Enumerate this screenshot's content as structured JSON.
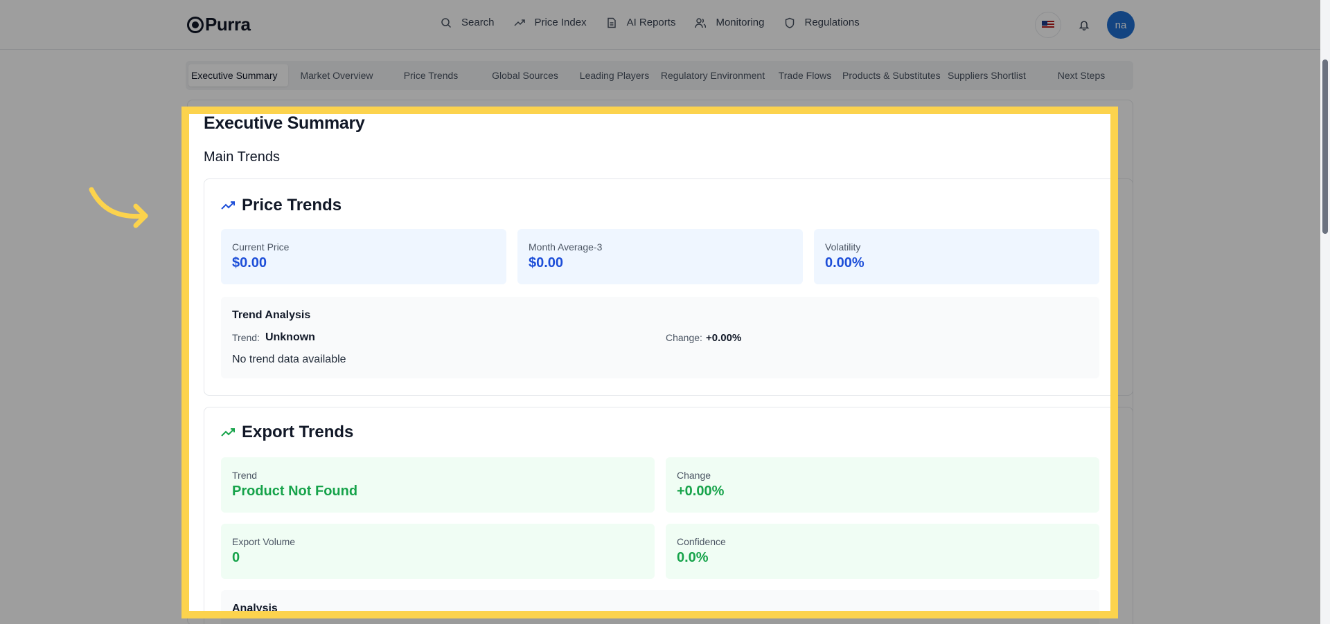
{
  "app": {
    "logo_text": "Purra"
  },
  "nav": [
    {
      "label": "Search",
      "icon": "search-icon"
    },
    {
      "label": "Price Index",
      "icon": "trending-up-icon"
    },
    {
      "label": "AI Reports",
      "icon": "document-icon"
    },
    {
      "label": "Monitoring",
      "icon": "users-icon"
    },
    {
      "label": "Regulations",
      "icon": "shield-icon"
    }
  ],
  "user": {
    "initials": "na",
    "flag": "us-flag-icon"
  },
  "tabs": [
    "Executive Summary",
    "Market Overview",
    "Price Trends",
    "Global Sources",
    "Leading Players",
    "Regulatory Environment",
    "Trade Flows",
    "Products & Substitutes",
    "Suppliers Shortlist",
    "Next Steps"
  ],
  "page": {
    "title": "Executive Summary",
    "subtitle": "Main Trends"
  },
  "price_trends": {
    "title": "Price Trends",
    "cards": [
      {
        "label": "Current Price",
        "value": "$0.00"
      },
      {
        "label": "Month Average-3",
        "value": "$0.00"
      },
      {
        "label": "Volatility",
        "value": "0.00%"
      }
    ],
    "analysis": {
      "title": "Trend Analysis",
      "trend_label": "Trend:",
      "trend_value": "Unknown",
      "change_label": "Change:",
      "change_value": "+0.00%",
      "description": "No trend data available"
    }
  },
  "export_trends": {
    "title": "Export Trends",
    "cards": [
      {
        "label": "Trend",
        "value": "Product Not Found"
      },
      {
        "label": "Change",
        "value": "+0.00%"
      },
      {
        "label": "Export Volume",
        "value": "0"
      },
      {
        "label": "Confidence",
        "value": "0.0%"
      }
    ],
    "analysis_title": "Analysis"
  },
  "colors": {
    "accent_blue": "#1d4ed8",
    "accent_green": "#16a34a",
    "highlight": "#fcd34d",
    "avatar": "#1f6fd1"
  }
}
